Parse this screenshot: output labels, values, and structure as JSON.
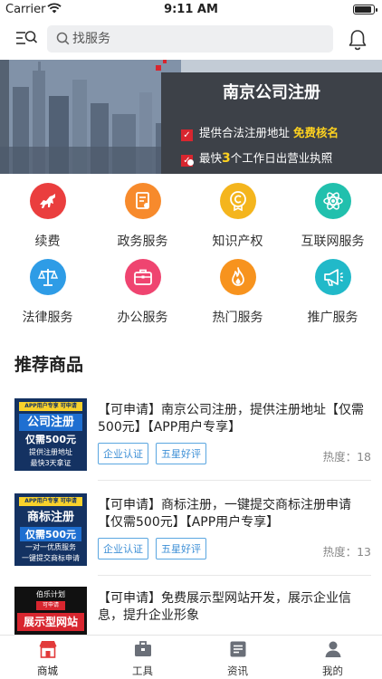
{
  "status": {
    "carrier": "Carrier",
    "time": "9:11 AM"
  },
  "search": {
    "placeholder": "找服务"
  },
  "banner": {
    "title": "南京公司注册",
    "line1_text": "提供合法注册地址",
    "line1_highlight": "免费核名",
    "line2_prefix": "最快",
    "line2_num": "3",
    "line2_suffix": "个工作日出营业执照"
  },
  "categories": [
    {
      "label": "续费",
      "icon": "horse-icon",
      "color": "#ea3e3e"
    },
    {
      "label": "政务服务",
      "icon": "document-icon",
      "color": "#f78a2c"
    },
    {
      "label": "知识产权",
      "icon": "copyright-icon",
      "color": "#f4b51d"
    },
    {
      "label": "互联网服务",
      "icon": "atom-icon",
      "color": "#21c0ad"
    },
    {
      "label": "法律服务",
      "icon": "scales-icon",
      "color": "#2e9ce6"
    },
    {
      "label": "办公服务",
      "icon": "briefcase-icon",
      "color": "#ef4470"
    },
    {
      "label": "热门服务",
      "icon": "flame-icon",
      "color": "#f7931e"
    },
    {
      "label": "推广服务",
      "icon": "megaphone-icon",
      "color": "#21b9c9"
    }
  ],
  "section": {
    "title": "推荐商品"
  },
  "products": [
    {
      "title": "【可申请】南京公司注册，提供注册地址【仅需500元】【APP用户专享】",
      "badges": [
        "企业认证",
        "五星好评"
      ],
      "heat_label": "热度：",
      "heat": "18",
      "thumb": {
        "tag": "APP用户专享 可申请",
        "t1": "公司注册",
        "t2": "仅需500元",
        "t3a": "提供注册地址",
        "t3b": "最快3天拿证"
      }
    },
    {
      "title": "【可申请】商标注册，一键提交商标注册申请【仅需500元】【APP用户专享】",
      "badges": [
        "企业认证",
        "五星好评"
      ],
      "heat_label": "热度：",
      "heat": "13",
      "thumb": {
        "tag": "APP用户专享 可申请",
        "t1": "商标注册",
        "t2": "仅需500元",
        "t3a": "一对一优质服务",
        "t3b": "一键提交商标申请"
      }
    },
    {
      "title": "【可申请】免费展示型网站开发，展示企业信息，提升企业形象",
      "thumb": {
        "tag": "伯乐计划",
        "tag2": "可申请",
        "t1": "展示型网站"
      }
    }
  ],
  "tabs": [
    {
      "label": "商城",
      "icon": "store-icon",
      "active": true
    },
    {
      "label": "工具",
      "icon": "toolbox-icon"
    },
    {
      "label": "资讯",
      "icon": "news-icon"
    },
    {
      "label": "我的",
      "icon": "user-icon"
    }
  ],
  "colors": {
    "accent": "#d8262f",
    "badge": "#3d8fd6",
    "panel": "#3d4148",
    "highlight": "#ffd21f"
  }
}
